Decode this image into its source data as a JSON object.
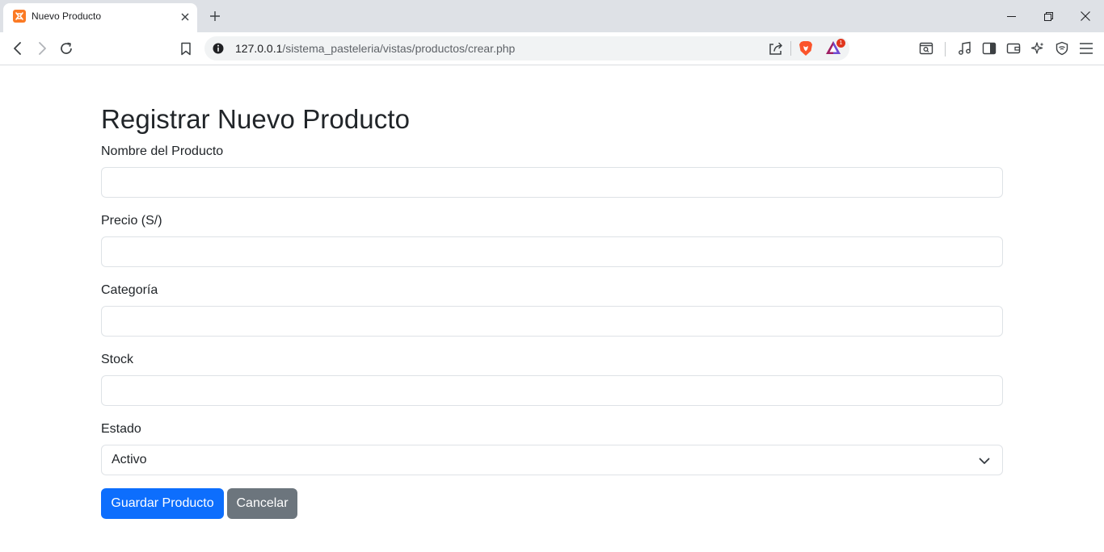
{
  "browser": {
    "tab_title": "Nuevo Producto",
    "url_host": "127.0.0.1",
    "url_path": "/sistema_pasteleria/vistas/productos/crear.php",
    "rewards_badge": "1",
    "colors": {
      "tab_bar": "#dee1e6",
      "favicon": "#fb7a24",
      "brave_orange": "#fb542b"
    }
  },
  "form": {
    "title": "Registrar Nuevo Producto",
    "fields": [
      {
        "label": "Nombre del Producto",
        "value": ""
      },
      {
        "label": "Precio (S/)",
        "value": ""
      },
      {
        "label": "Categoría",
        "value": ""
      },
      {
        "label": "Stock",
        "value": ""
      }
    ],
    "estado": {
      "label": "Estado",
      "selected": "Activo"
    },
    "buttons": {
      "save": "Guardar Producto",
      "cancel": "Cancelar"
    },
    "colors": {
      "primary": "#0d6efd",
      "secondary": "#6c757d",
      "border": "#dee2e6"
    }
  }
}
